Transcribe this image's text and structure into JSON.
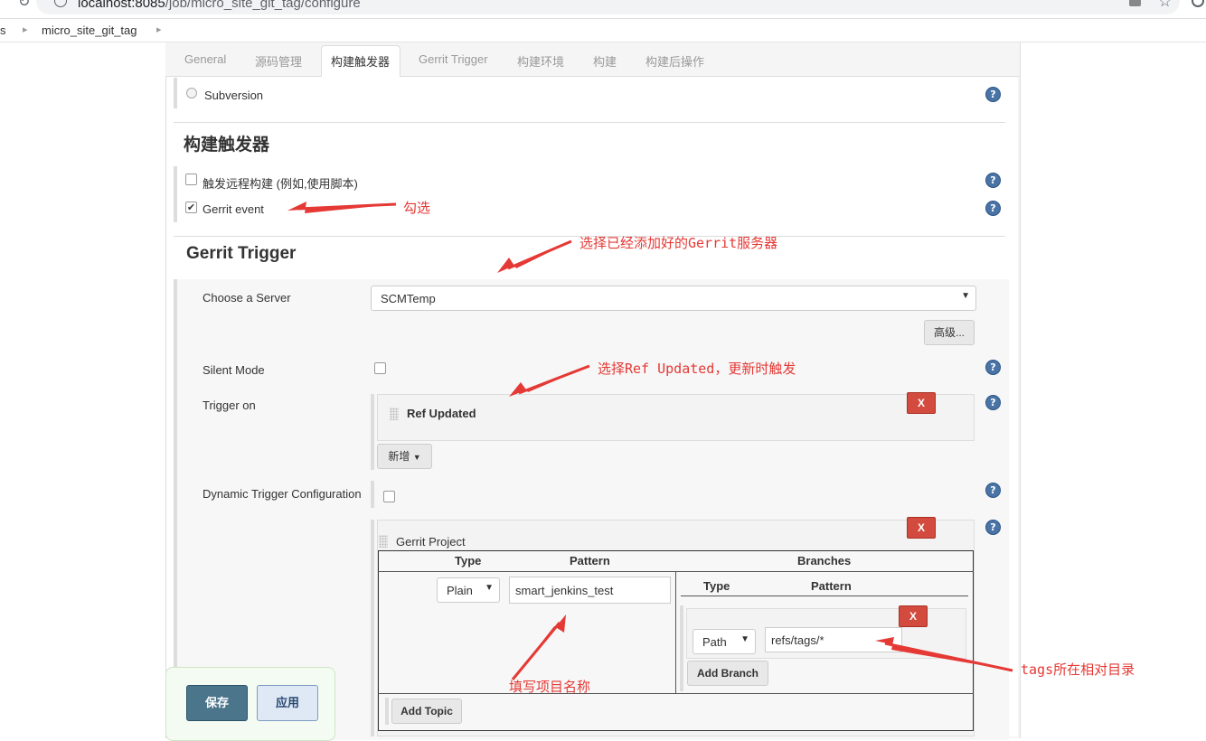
{
  "browser": {
    "url_host": "localhost:8085",
    "url_path": "/job/micro_site_git_tag/configure"
  },
  "breadcrumb": {
    "first": "s",
    "job": "micro_site_git_tag"
  },
  "tabs": [
    "General",
    "源码管理",
    "构建触发器",
    "Gerrit Trigger",
    "构建环境",
    "构建",
    "构建后操作"
  ],
  "scm": {
    "subversion_label": "Subversion"
  },
  "triggers": {
    "title": "构建触发器",
    "remote_label": "触发远程构建 (例如,使用脚本)",
    "gerrit_event_label": "Gerrit event",
    "gerrit_event_checked": true
  },
  "gerrit": {
    "title": "Gerrit Trigger",
    "server_label": "Choose a Server",
    "server_value": "SCMTemp",
    "advanced_button": "高级...",
    "silent_label": "Silent Mode",
    "trigger_on_label": "Trigger on",
    "ref_updated_label": "Ref Updated",
    "add_button": "新增",
    "dynamic_label": "Dynamic Trigger Configuration",
    "delete_label": "X",
    "project": {
      "section_label": "Gerrit Project",
      "col_type": "Type",
      "col_pattern": "Pattern",
      "col_branches": "Branches",
      "type_value": "Plain",
      "pattern_value": "smart_jenkins_test",
      "branch_col_type": "Type",
      "branch_col_pattern": "Pattern",
      "branch_type_value": "Path",
      "branch_pattern_value": "refs/tags/*",
      "add_branch_button": "Add Branch",
      "add_topic_button": "Add Topic"
    }
  },
  "annotations": {
    "check": "勾选",
    "select_server": "选择已经添加好的Gerrit服务器",
    "ref_updated": "选择Ref Updated，更新时触发",
    "project_name": "填写项目名称",
    "tags_path": "tags所在相对目录"
  },
  "actions": {
    "save": "保存",
    "apply": "应用"
  },
  "colors": {
    "annotation": "#e53935",
    "delete_button": "#d24b3e",
    "save_button": "#4b758b",
    "help_icon": "#4a74a6"
  }
}
